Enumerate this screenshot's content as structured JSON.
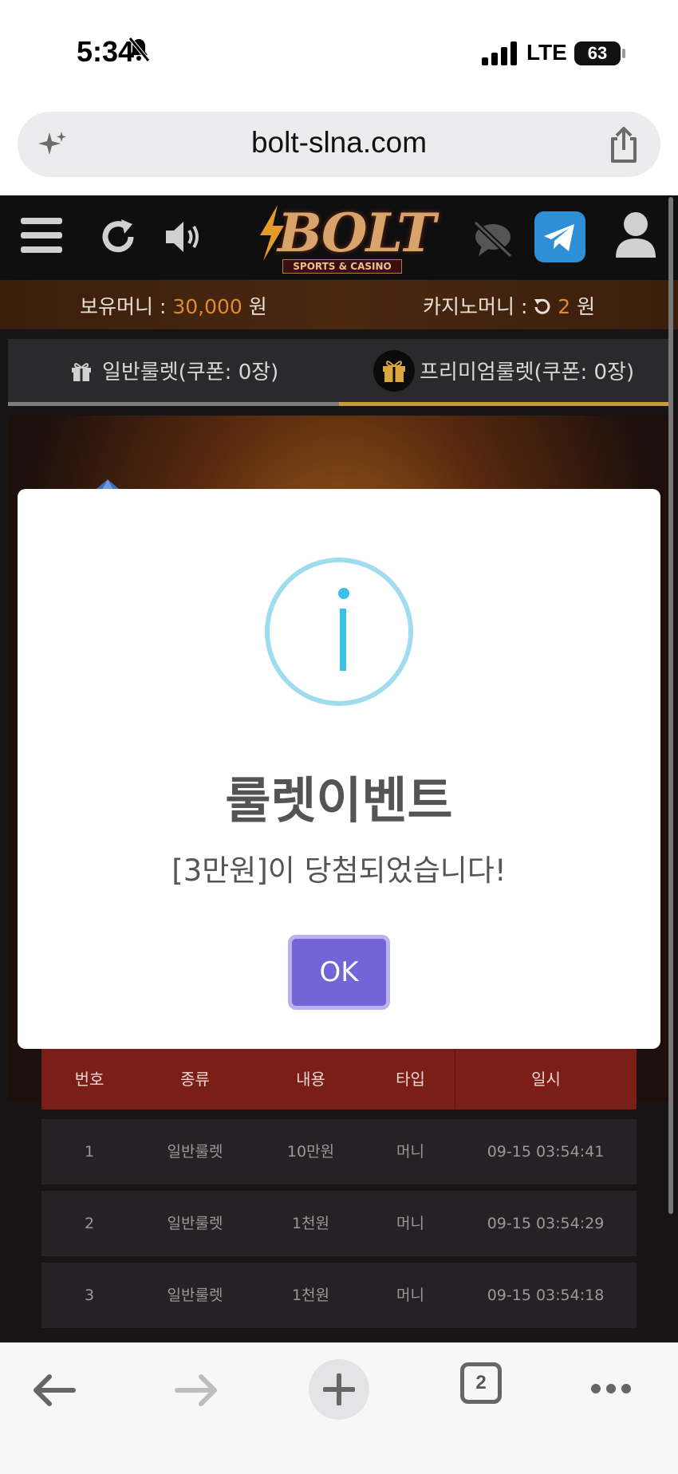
{
  "status_bar": {
    "time": "5:34",
    "network": "LTE",
    "battery": "63"
  },
  "browser": {
    "url": "bolt-slna.com",
    "tab_count": "2"
  },
  "site": {
    "logo": {
      "main": "BOLT",
      "sub": "SPORTS & CASINO"
    },
    "money": {
      "held_label": "보유머니 :",
      "held_value": "30,000",
      "held_unit": "원",
      "casino_label": "카지노머니 :",
      "casino_value": "2",
      "casino_unit": "원"
    },
    "tabs": [
      {
        "label": "일반룰렛(쿠폰: 0장)"
      },
      {
        "label": "프리미엄룰렛(쿠폰: 0장)"
      }
    ],
    "history": {
      "headers": [
        "번호",
        "종류",
        "내용",
        "타입",
        "일시"
      ],
      "rows": [
        [
          "1",
          "일반룰렛",
          "10만원",
          "머니",
          "09-15 03:54:41"
        ],
        [
          "2",
          "일반룰렛",
          "1천원",
          "머니",
          "09-15 03:54:29"
        ],
        [
          "3",
          "일반룰렛",
          "1천원",
          "머니",
          "09-15 03:54:18"
        ]
      ]
    }
  },
  "modal": {
    "icon": "info-icon",
    "title": "룰렛이벤트",
    "message": "[3만원]이 당첨되었습니다!",
    "ok_label": "OK"
  },
  "colors": {
    "accent_orange": "#e08a2e",
    "modal_button": "#7364d8",
    "info_icon": "#3ebfe6",
    "table_header": "#7c1e18"
  }
}
